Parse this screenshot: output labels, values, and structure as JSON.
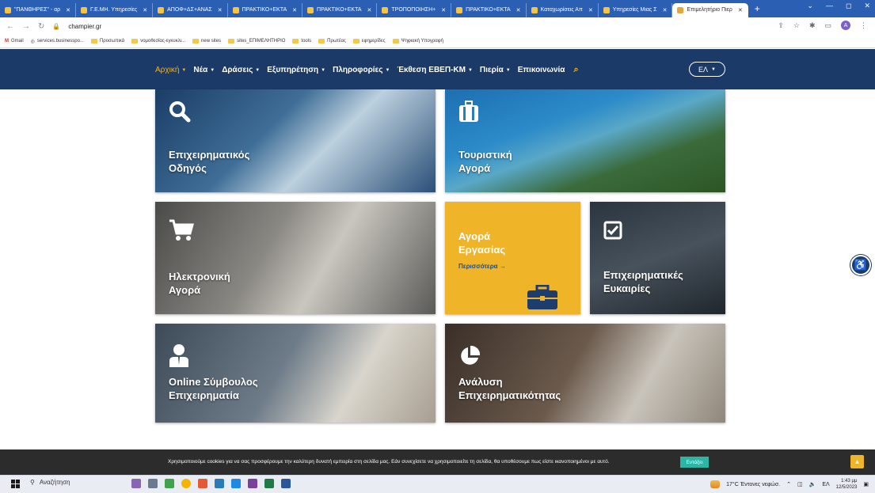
{
  "browser": {
    "tabs": [
      {
        "label": "\"ΠΑΝΘΗΡΕΣ\" - αρ"
      },
      {
        "label": "Γ.Ε.ΜΗ. Υπηρεσίες"
      },
      {
        "label": "ΑΠΟΦ+ΔΣ+ΑΝΑΣ"
      },
      {
        "label": "ΠΡΑΚΤΙΚΟ+ΕΚΤΑ"
      },
      {
        "label": "ΠΡΑΚΤΙΚΟ+ΕΚΤΑ"
      },
      {
        "label": "ΤΡΟΠΟΠΟΙΗΣΗ+"
      },
      {
        "label": "ΠΡΑΚΤΙΚΟ+ΕΚΤΑ"
      },
      {
        "label": "Καταχωρίσεις Απ"
      },
      {
        "label": "Υπηρεσίες Μιας Σ"
      },
      {
        "label": "Επιμελητήριο Πιερ",
        "active": true
      }
    ],
    "url": "champier.gr",
    "bookmarks": [
      "Gmail",
      "services.businesspo...",
      "Προσωπικά",
      "νομοθεσίας-εγκυκλι...",
      "new sites",
      "sites_ΕΠΙΜΕΛΗΤΗΡΙΟ",
      "tools",
      "Πρωτέας",
      "εφημερίδες",
      "Ψηφιακή Υπογραφή"
    ],
    "profile_initial": "A"
  },
  "nav": {
    "items": [
      {
        "label": "Αρχική",
        "active": true
      },
      {
        "label": "Νέα"
      },
      {
        "label": "Δράσεις"
      },
      {
        "label": "Εξυπηρέτηση"
      },
      {
        "label": "Πληροφορίες"
      },
      {
        "label": "Έκθεση ΕΒΕΠ-ΚΜ"
      },
      {
        "label": "Πιερία"
      },
      {
        "label": "Επικοινωνία"
      }
    ],
    "language": "ΕΛ"
  },
  "tiles": {
    "guide": {
      "line1": "Επιχειρηματικός",
      "line2": "Οδηγός",
      "icon": "search-icon"
    },
    "tourism": {
      "line1": "Τουριστική",
      "line2": "Αγορά",
      "icon": "suitcase-icon"
    },
    "eshop": {
      "line1": "Ηλεκτρονική",
      "line2": "Αγορά",
      "icon": "cart-icon"
    },
    "jobs": {
      "line1": "Αγορά",
      "line2": "Εργασίας",
      "more": "Περισσότερα →",
      "icon": "briefcase-icon"
    },
    "opportunities": {
      "line1": "Επιχειρηματικές",
      "line2": "Ευκαιρίες",
      "icon": "checkbox-icon"
    },
    "advisor": {
      "line1": "Online Σύμβουλος",
      "line2": "Επιχειρηματία",
      "icon": "user-icon"
    },
    "analysis": {
      "line1": "Ανάλυση",
      "line2": "Επιχειρηματικότητας",
      "icon": "pie-chart-icon"
    }
  },
  "cookie": {
    "text": "Χρησιμοποιούμε cookies για να σας προσφέρουμε την καλύτερη δυνατή εμπειρία στη σελίδα μας. Εάν συνεχίσετε να χρησιμοποιείτε τη σελίδα, θα υποθέσουμε πως είστε ικανοποιημένοι με αυτό.",
    "accept": "Εντάξει"
  },
  "taskbar": {
    "search_placeholder": "Αναζήτηση",
    "weather": "17°C  Έντονες νεφώσ.",
    "lang": "ΕΛ",
    "time": "1:43 μμ",
    "date": "12/5/2023"
  },
  "colors": {
    "header": "#1c3a68",
    "accent": "#f0b429",
    "tile_jobs": "#f0b429"
  }
}
